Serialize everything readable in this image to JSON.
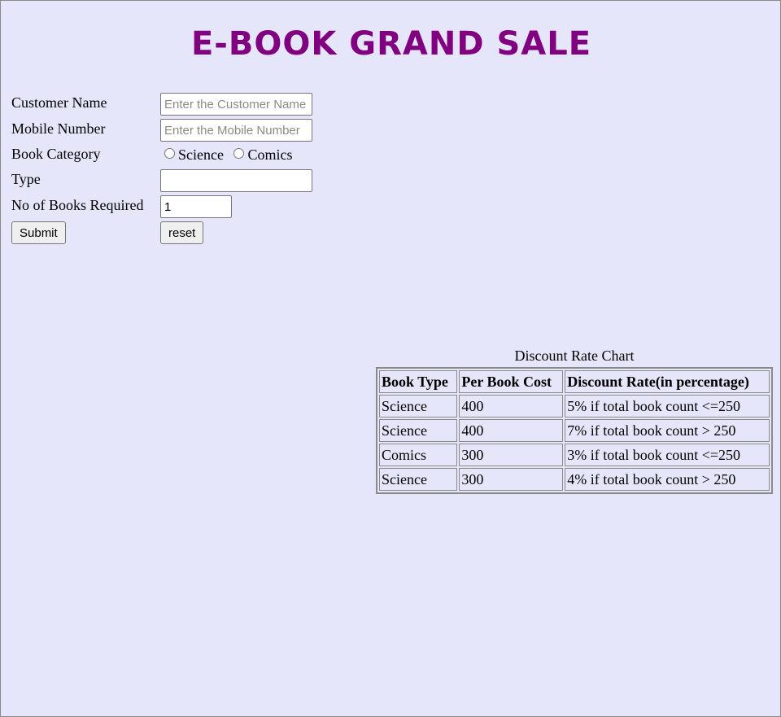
{
  "page": {
    "title": "E-BOOK GRAND SALE"
  },
  "form": {
    "customer_name": {
      "label": "Customer Name",
      "placeholder": "Enter the Customer Name",
      "value": ""
    },
    "mobile_number": {
      "label": "Mobile Number",
      "placeholder": "Enter the Mobile Number",
      "value": ""
    },
    "book_category": {
      "label": "Book Category",
      "options": [
        "Science",
        "Comics"
      ],
      "selected": null
    },
    "type": {
      "label": "Type",
      "value": ""
    },
    "books_required": {
      "label": "No of Books Required",
      "value": "1"
    },
    "submit_label": "Submit",
    "reset_label": "reset"
  },
  "discount_chart": {
    "caption": "Discount Rate Chart",
    "headers": [
      "Book Type",
      "Per Book Cost",
      "Discount Rate(in percentage)"
    ],
    "rows": [
      [
        "Science",
        "400",
        "5% if total book count <=250"
      ],
      [
        "Science",
        "400",
        "7% if total book count > 250"
      ],
      [
        "Comics",
        "300",
        "3% if total book count <=250"
      ],
      [
        "Science",
        "300",
        "4% if total book count > 250"
      ]
    ]
  }
}
